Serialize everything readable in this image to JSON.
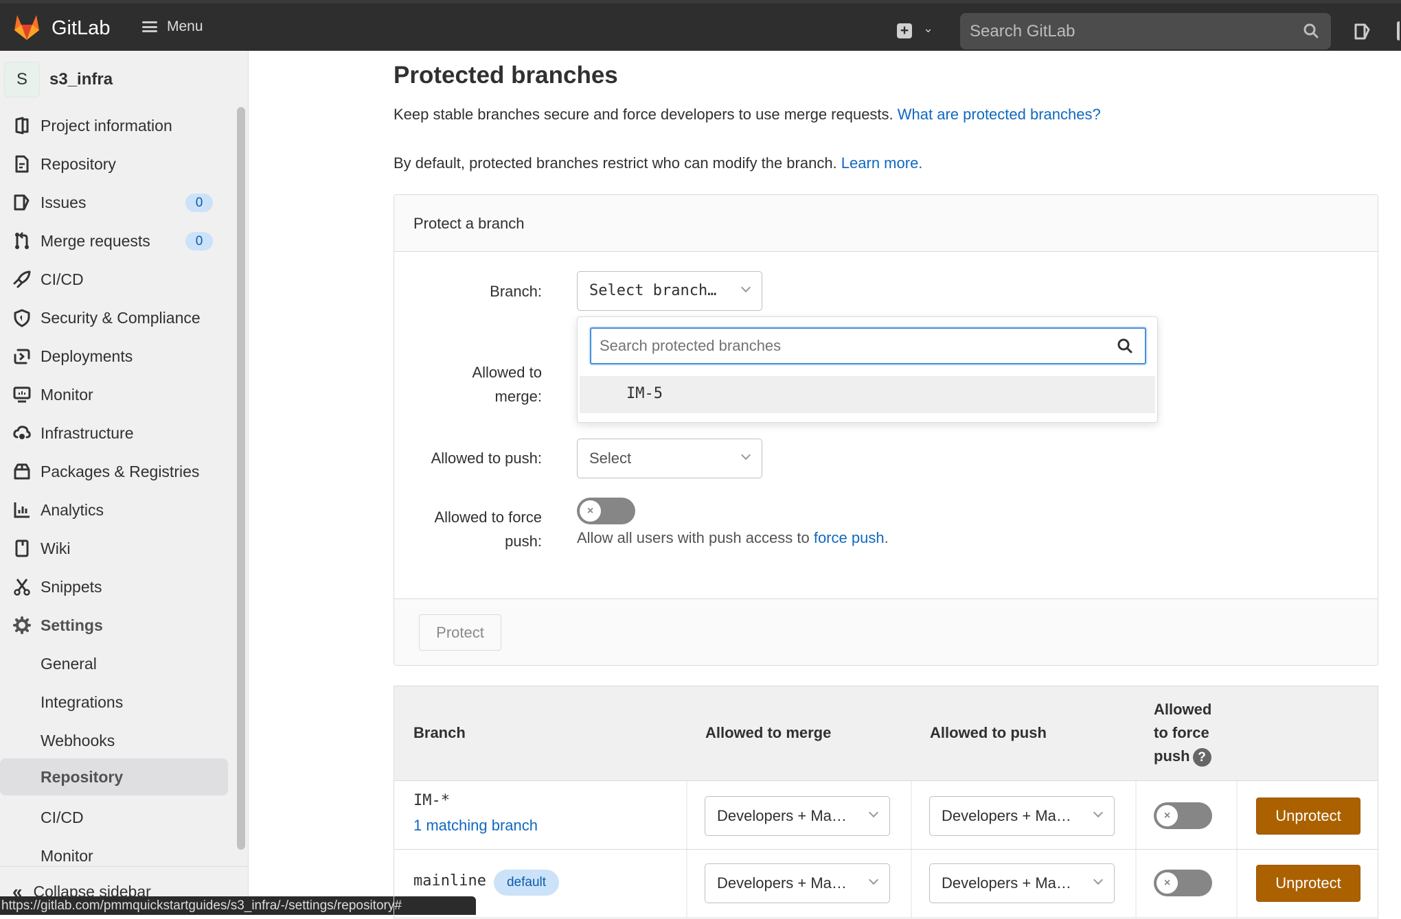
{
  "navbar": {
    "brand": "GitLab",
    "menu_label": "Menu",
    "search_placeholder": "Search GitLab"
  },
  "sidebar": {
    "project_initial": "S",
    "project_name": "s3_infra",
    "items": [
      {
        "label": "Project information",
        "icon": "project-info-icon"
      },
      {
        "label": "Repository",
        "icon": "repository-icon"
      },
      {
        "label": "Issues",
        "icon": "issues-icon",
        "badge": "0"
      },
      {
        "label": "Merge requests",
        "icon": "merge-request-icon",
        "badge": "0"
      },
      {
        "label": "CI/CD",
        "icon": "rocket-icon"
      },
      {
        "label": "Security & Compliance",
        "icon": "shield-icon"
      },
      {
        "label": "Deployments",
        "icon": "deployments-icon"
      },
      {
        "label": "Monitor",
        "icon": "monitor-icon"
      },
      {
        "label": "Infrastructure",
        "icon": "cloud-gear-icon"
      },
      {
        "label": "Packages & Registries",
        "icon": "package-icon"
      },
      {
        "label": "Analytics",
        "icon": "chart-icon"
      },
      {
        "label": "Wiki",
        "icon": "book-icon"
      },
      {
        "label": "Snippets",
        "icon": "scissors-icon"
      },
      {
        "label": "Settings",
        "icon": "gear-icon"
      }
    ],
    "settings_subitems": [
      "General",
      "Integrations",
      "Webhooks",
      "Repository",
      "CI/CD",
      "Monitor"
    ],
    "active_subitem": "Repository",
    "collapse_label": "Collapse sidebar"
  },
  "status_url": "https://gitlab.com/pmmquickstartguides/s3_infra/-/settings/repository#",
  "main": {
    "title": "Protected branches",
    "desc1": "Keep stable branches secure and force developers to use merge requests.",
    "desc1_link": "What are protected branches?",
    "desc2": "By default, protected branches restrict who can modify the branch.",
    "desc2_link": "Learn more.",
    "panel": {
      "heading": "Protect a branch",
      "branch_label": "Branch:",
      "branch_select": "Select branch…",
      "merge_label_1": "Allowed to",
      "merge_label_2": "merge:",
      "push_label": "Allowed to push:",
      "push_select": "Select",
      "force_label_1": "Allowed to force",
      "force_label_2": "push:",
      "force_help": "Allow all users with push access to",
      "force_help_link": "force push",
      "force_help_end": ".",
      "force_enabled": false,
      "protect_button": "Protect",
      "dropdown": {
        "search_placeholder": "Search protected branches",
        "items": [
          "IM-5"
        ]
      }
    },
    "table": {
      "headers": {
        "branch": "Branch",
        "merge": "Allowed to merge",
        "push": "Allowed to push",
        "force_1": "Allowed",
        "force_2": "to force",
        "force_3": "push"
      },
      "rows": [
        {
          "branch": "IM-*",
          "sub_link": "1 matching branch",
          "merge": "Developers + Ma…",
          "push": "Developers + Ma…",
          "force": false,
          "action": "Unprotect"
        },
        {
          "branch": "mainline",
          "badge": "default",
          "merge": "Developers + Ma…",
          "push": "Developers + Ma…",
          "force": false,
          "action": "Unprotect"
        }
      ]
    }
  },
  "colors": {
    "navbar": "#2e2e2e",
    "link": "#1068bf",
    "unprotect": "#ab6100",
    "badge_bg": "#cbe2f9",
    "focus": "#428fdc"
  }
}
